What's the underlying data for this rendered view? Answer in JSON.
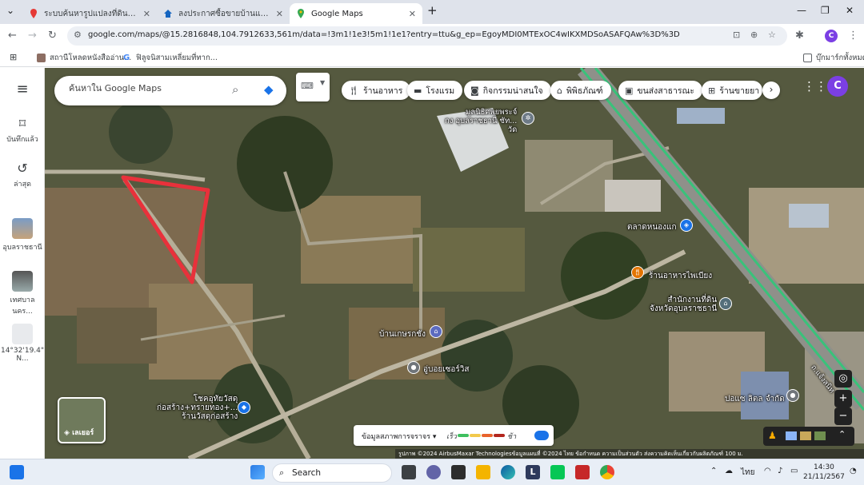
{
  "browser": {
    "tabs": [
      {
        "label": "ระบบค้นหารูปแปลงที่ดิน (LandsMaps)",
        "active": false
      },
      {
        "label": "ลงประกาศซื้อขายบ้านและที่ดินฟรี | ที่ดิน",
        "active": false
      },
      {
        "label": "Google Maps",
        "active": true
      }
    ],
    "new_tab": "+",
    "url": "google.com/maps/@15.2816848,104.7912633,561m/data=!3m1!1e3!5m1!1e1?entry=ttu&g_ep=EgoyMDI0MTExOC4wIKXMDSoASAFQAw%3D%3D",
    "profile_initial": "C",
    "bookmarks": [
      {
        "label": "สถานีโหลดหนังสืออ่าน..."
      },
      {
        "label": "ฟิลูจนิสามเหลี่ยมที่ทาก..."
      }
    ],
    "all_bookmarks": "บุ๊กมาร์กทั้งหมด"
  },
  "sidebar": {
    "menu": "menu",
    "saved": "บันทึกแล้ว",
    "recent": "ล่าสุด",
    "recent_places": [
      {
        "label": "อุบลราชธานี"
      },
      {
        "label": "เทศบาลนคร..."
      },
      {
        "label": "14°32'19.4\" N..."
      }
    ]
  },
  "map": {
    "search_placeholder": "ค้นหาใน Google Maps",
    "chips": [
      {
        "label": "ร้านอาหาร",
        "icon": "fork-knife-icon"
      },
      {
        "label": "โรงแรม",
        "icon": "bed-icon"
      },
      {
        "label": "กิจกรรมน่าสนใจ",
        "icon": "camera-icon"
      },
      {
        "label": "พิพิธภัณฑ์",
        "icon": "museum-icon"
      },
      {
        "label": "ขนส่งสาธารณะ",
        "icon": "bus-icon"
      },
      {
        "label": "ร้านขายยา",
        "icon": "pharmacy-icon"
      }
    ],
    "account_initial": "C",
    "pois": [
      {
        "label": "มูลนิธิศพยพระจ์\nกง อุบลราชธานี ซัท...\nวัด"
      },
      {
        "label": "ตลาดหนองแก"
      },
      {
        "label": "ร้านอาหารไพเบียง"
      },
      {
        "label": "สำนักงานที่ดิน\nจังหวัดอุบลราชธานี"
      },
      {
        "label": "บ้านเกษรกชัง"
      },
      {
        "label": "อู่บอยเซอร์วิส"
      },
      {
        "label": "โชคอุทัยวัสดุ\nก่อสร้าง+ทรายทอง+...\nร้านวัสดุก่อสร้าง"
      },
      {
        "label": "ปอแซ ลิตล จำกัด"
      },
      {
        "label": "ถ.แจ้งสนิท"
      }
    ],
    "layers_label": "เลเยอร์",
    "traffic": {
      "label": "ข้อมูลสภาพการจราจร",
      "fast": "เร็ว",
      "slow": "ช้า",
      "colors": [
        "#3fbf5f",
        "#f2c94c",
        "#e8632c",
        "#b3261e"
      ]
    },
    "attribution": "รูปภาพ ©2024 AirbusMaxar Technologiesข้อมูลแผนที่ ©2024   ไทย   ข้อกำหนด   ความเป็นส่วนตัว   ส่งความคิดเห็นเกี่ยวกับผลิตภัณฑ์   100 ม."
  },
  "taskbar": {
    "search": "Search",
    "lang": "ไทย",
    "time": "14:30",
    "date": "21/11/2567"
  },
  "colors": {
    "annotation": "#e8313b",
    "road_green": "#39c27a",
    "accent": "#7b3fe4"
  }
}
